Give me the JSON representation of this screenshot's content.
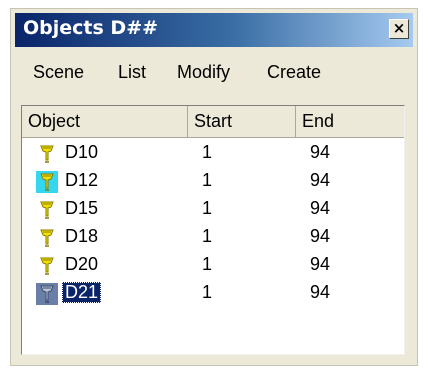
{
  "window": {
    "title": "Objects D##",
    "close_glyph": "×"
  },
  "menu": {
    "items": [
      {
        "label": "Scene"
      },
      {
        "label": "List"
      },
      {
        "label": "Modify"
      },
      {
        "label": "Create"
      }
    ]
  },
  "list": {
    "columns": [
      {
        "label": "Object"
      },
      {
        "label": "Start"
      },
      {
        "label": "End"
      }
    ],
    "rows": [
      {
        "name": "D10",
        "start": "1",
        "end": "94",
        "icon": "lamp-icon"
      },
      {
        "name": "D12",
        "start": "1",
        "end": "94",
        "icon": "lamp-icon",
        "icon_state": "highlighted"
      },
      {
        "name": "D15",
        "start": "1",
        "end": "94",
        "icon": "lamp-icon"
      },
      {
        "name": "D18",
        "start": "1",
        "end": "94",
        "icon": "lamp-icon"
      },
      {
        "name": "D20",
        "start": "1",
        "end": "94",
        "icon": "lamp-icon"
      },
      {
        "name": "D21",
        "start": "1",
        "end": "94",
        "icon": "lamp-icon",
        "selected": true
      }
    ]
  },
  "colors": {
    "title_start": "#0a246a",
    "title_end": "#a6caf0",
    "icon_yellow": "#f2e200",
    "icon_highlight_bg": "#35d6f0",
    "selection": "#0a246a"
  }
}
